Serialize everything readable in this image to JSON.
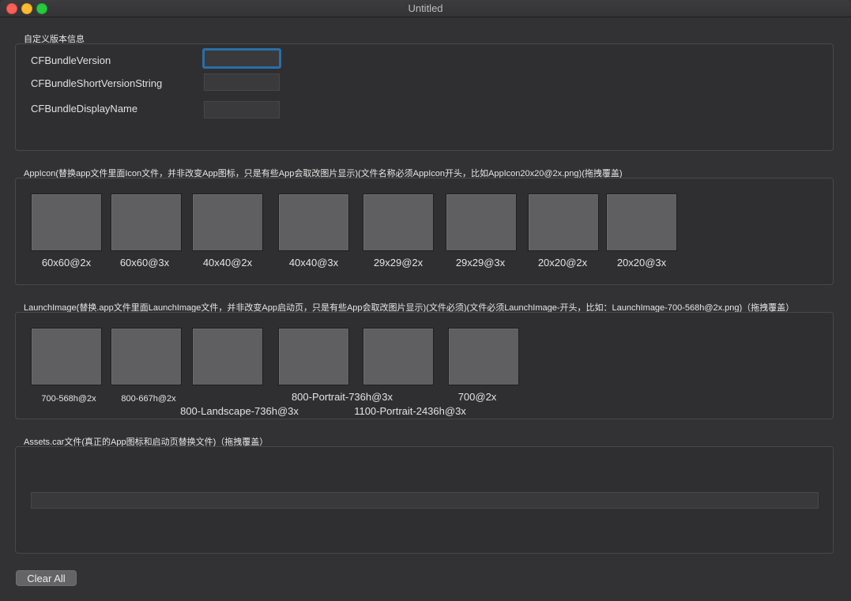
{
  "window": {
    "title": "Untitled"
  },
  "version_section": {
    "label": "自定义版本信息",
    "fields": [
      {
        "label": "CFBundleVersion",
        "value": ""
      },
      {
        "label": "CFBundleShortVersionString",
        "value": ""
      },
      {
        "label": "CFBundleDisplayName",
        "value": ""
      }
    ]
  },
  "appicon_section": {
    "label": "AppIcon(替换app文件里面Icon文件，并非改变App图标，只是有些App会取改图片显示)(文件名称必须AppIcon开头，比如AppIcon20x20@2x.png)(拖拽覆盖)",
    "items": [
      "60x60@2x",
      "60x60@3x",
      "40x40@2x",
      "40x40@3x",
      "29x29@2x",
      "29x29@3x",
      "20x20@2x",
      "20x20@3x"
    ]
  },
  "launch_section": {
    "label": "LaunchImage(替换.app文件里面LaunchImage文件，并非改变App启动页，只是有些App会取改图片显示)(文件必须)(文件必须LaunchImage-开头，比如：LaunchImage-700-568h@2x.png)（拖拽覆盖）",
    "items": [
      "700-568h@2x",
      "800-667h@2x",
      "800-Landscape-736h@3x",
      "800-Portrait-736h@3x",
      "1100-Portrait-2436h@3x",
      "700@2x"
    ]
  },
  "assets_section": {
    "label": "Assets.car文件(真正的App图标和启动页替换文件)（拖拽覆盖）",
    "value": ""
  },
  "clear_button": {
    "label": "Clear All"
  }
}
